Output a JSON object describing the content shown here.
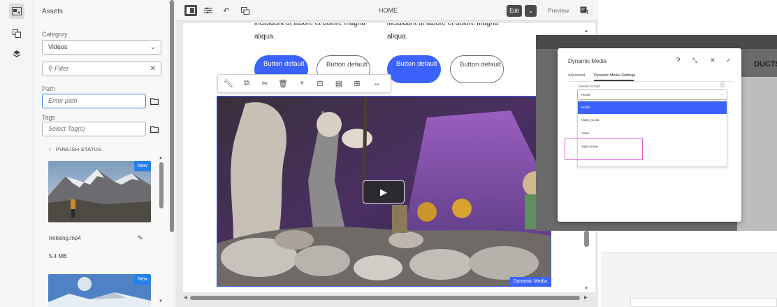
{
  "rail": {
    "icons": [
      "assets-icon",
      "components-icon",
      "layers-icon"
    ]
  },
  "assets_panel": {
    "title": "Assets",
    "category_label": "Category",
    "category_value": "Videos",
    "filter_placeholder": "Filter",
    "path_label": "Path",
    "path_placeholder": "Enter path",
    "tags_label": "Tags",
    "tags_placeholder": "Select Tag(s)",
    "publish_status": "PUBLISH STATUS",
    "items": [
      {
        "badge": "New",
        "name": "trekking.mp4",
        "size": "5.4 MB"
      },
      {
        "badge": "New"
      }
    ]
  },
  "toolbar": {
    "page_title": "HOME",
    "edit_label": "Edit",
    "preview_label": "Preview"
  },
  "page": {
    "text_col1_line1": "incididunt ut labore et dolore magna",
    "text_col1_line2": "aliqua.",
    "text_col2_line1": "incididunt ut labore et dolore magna",
    "text_col2_line2": "aliqua.",
    "buttons": [
      {
        "label": "Button default",
        "style": "primary"
      },
      {
        "label": "Button default",
        "style": "secondary"
      },
      {
        "label": "Button default",
        "style": "primary"
      },
      {
        "label": "Button default",
        "style": "secondary"
      }
    ],
    "video_tag": "Dynamic Media"
  },
  "dialog": {
    "title": "Dynamic Media",
    "tabs": [
      "Advanced",
      "Dynamic Media Settings"
    ],
    "viewer_preset_label": "Viewer Preset",
    "select_value": "NONE",
    "options": [
      "NONE",
      "Video_social",
      "Video",
      "Video (new)"
    ],
    "selected_option": "NONE",
    "background_heading": "DUCTS"
  },
  "colors": {
    "accent": "#3b63fb",
    "highlight": "#e15fe3",
    "selected_bg": "#2680eb"
  }
}
